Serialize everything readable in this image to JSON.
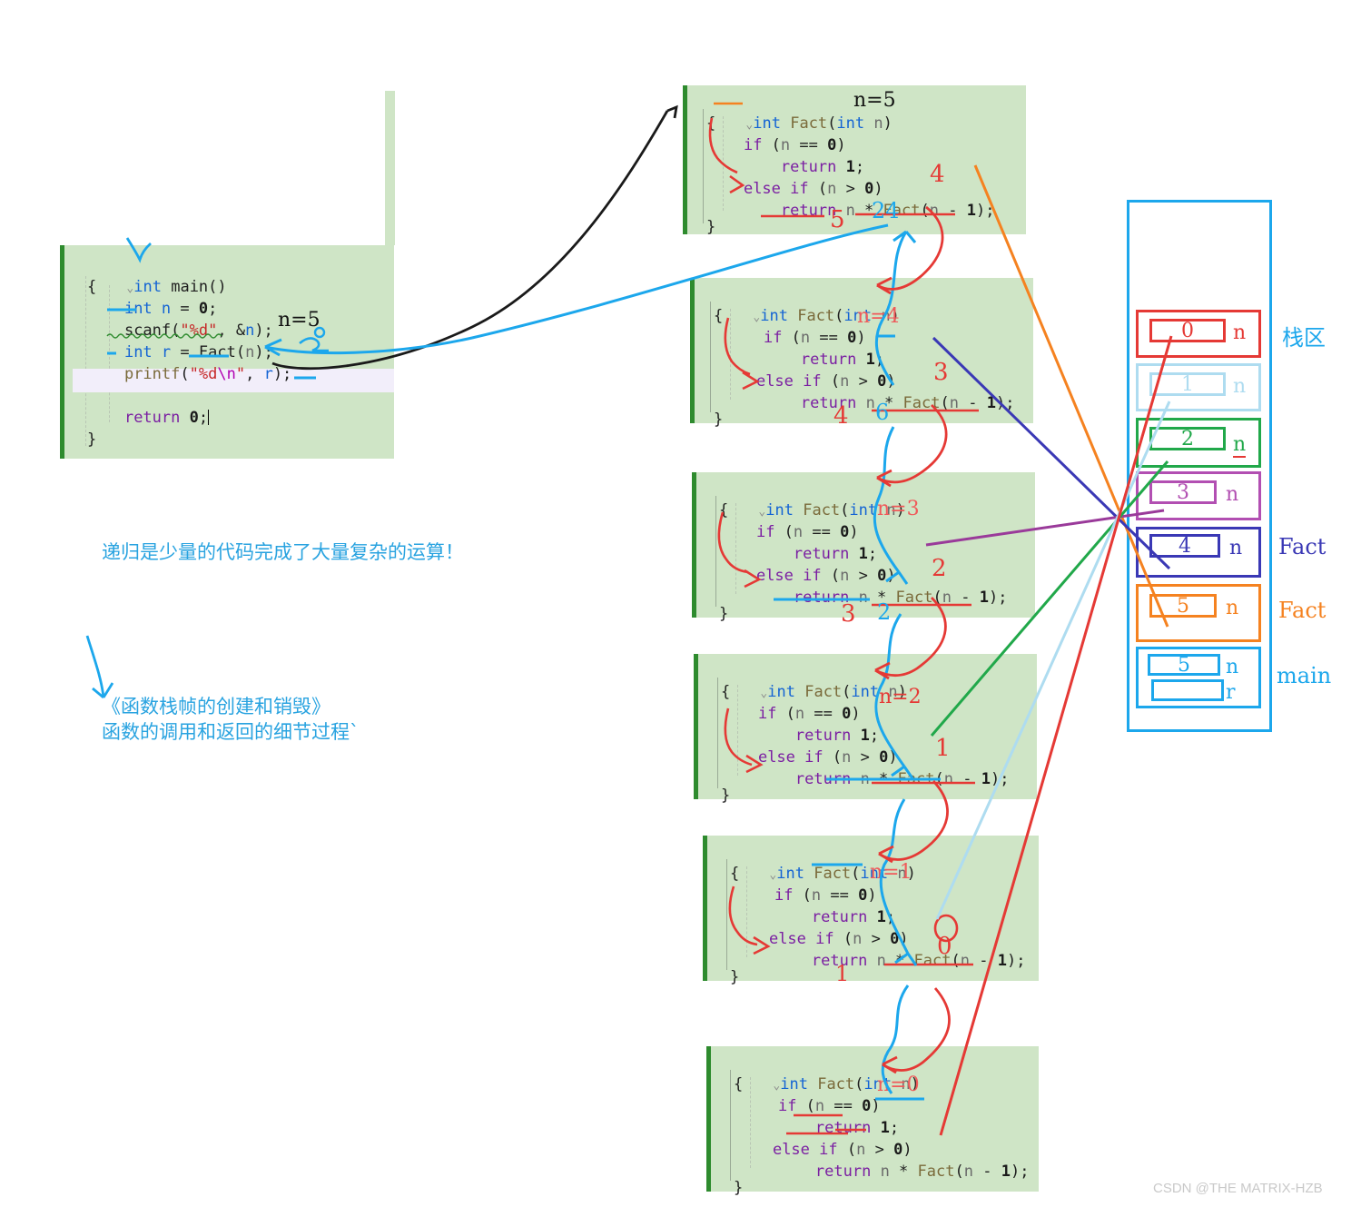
{
  "watermark": "CSDN @THE MATRIX-HZB",
  "code_lines": {
    "main": [
      "int main()",
      "{",
      "    int n = 0;",
      "    scanf(\"%d\", &n);",
      "    int r = Fact(n);",
      "    printf(\"%d\\n\", r);",
      "",
      "    return 0;",
      "}"
    ],
    "fact": [
      "int Fact(int n)",
      "{",
      "    if (n == 0)",
      "        return 1;",
      "    else if (n > 0)",
      "        return n * Fact(n - 1);",
      "}"
    ]
  },
  "main_block": {
    "title": "int main()",
    "open_brace": "{",
    "line_decl": "int n = 0;",
    "line_scanf": "scanf(\"%d\", &n);",
    "line_call": "int r = Fact(n);",
    "line_printf": "printf(\"%d\\n\", r);",
    "line_return": "return 0;",
    "close_brace": "}",
    "annotation_n": "n=5"
  },
  "fact_blocks": [
    {
      "id": "fact-n5",
      "signature": "int Fact(int n)",
      "annotation": "n=5",
      "annotation_color": "#111111",
      "marks": [
        "4",
        "5",
        "24"
      ]
    },
    {
      "id": "fact-n4",
      "signature": "int Fact(int n)",
      "annotation": "n=4",
      "annotation_color": "#f05a5a",
      "marks": [
        "3",
        "4",
        "6"
      ]
    },
    {
      "id": "fact-n3",
      "signature": "int Fact(int n)",
      "annotation": "n=3",
      "annotation_color": "#f05a5a",
      "marks": [
        "2",
        "3"
      ]
    },
    {
      "id": "fact-n2",
      "signature": "int Fact(int n)",
      "annotation": "n=2",
      "annotation_color": "#e53935",
      "marks": [
        "1"
      ]
    },
    {
      "id": "fact-n1",
      "signature": "int Fact(int n)",
      "annotation": "n=1",
      "annotation_color": "#f05a5a",
      "marks": [
        "0",
        "1"
      ]
    },
    {
      "id": "fact-n0",
      "signature": "int Fact(int n)",
      "annotation": "n=0",
      "annotation_color": "#f05a5a",
      "marks": []
    }
  ],
  "fact_code": {
    "open_brace": "{",
    "if_line": "if (n == 0)",
    "return_one": "return 1;",
    "elseif_line": "else if (n > 0)",
    "return_rec": "return n * Fact(n - 1);",
    "close_brace": "}"
  },
  "notes": {
    "line1": "递归是少量的代码完成了大量复杂的运算！",
    "line2": "《函数栈帧的创建和销毁》",
    "line3": "函数的调用和返回的细节过程`"
  },
  "stack": {
    "region_label": "栈区",
    "frames": [
      {
        "value": "0",
        "var": "n",
        "color": "#e53935",
        "side_label": ""
      },
      {
        "value": "1",
        "var": "n",
        "color": "#aedcf0",
        "side_label": ""
      },
      {
        "value": "2",
        "var": "n",
        "color": "#21a84a",
        "side_label": ""
      },
      {
        "value": "3",
        "var": "n",
        "color": "#b24fb2",
        "side_label": ""
      },
      {
        "value": "4",
        "var": "n",
        "color": "#3a38b5",
        "side_label": "Fact"
      },
      {
        "value": "5",
        "var": "n",
        "color": "#f58220",
        "side_label": "Fact"
      },
      {
        "value": "5",
        "var": "n",
        "var2": "r",
        "value2": "",
        "color": "#1ca7ec",
        "side_label": "main"
      }
    ]
  },
  "colors": {
    "code_bg": "#cfe5c6",
    "gutter": "#2e8b2e",
    "keyword": "#7b1fa2",
    "type": "#1464d4",
    "function": "#7a6a3a",
    "string": "#c62828",
    "pen_red": "#e53935",
    "pen_blue": "#1ca7ec",
    "pen_black": "#111111"
  }
}
